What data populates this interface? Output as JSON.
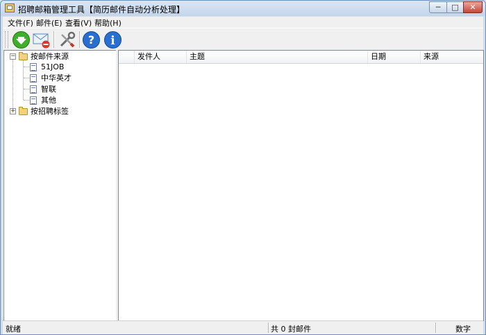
{
  "window": {
    "title": "招聘邮箱管理工具【简历邮件自动分析处理】",
    "minimize": "─",
    "maximize": "□",
    "close": "✕"
  },
  "menu": [
    "文件(F)",
    "邮件(E)",
    "查看(V)",
    "帮助(H)"
  ],
  "toolbar": {
    "buttons": [
      {
        "icon": "download-arrow-icon"
      },
      {
        "icon": "mail-delete-icon"
      },
      {
        "icon": "tools-icon"
      },
      {
        "icon": "help-icon",
        "glyph": "?"
      },
      {
        "icon": "info-icon",
        "glyph": "i"
      }
    ]
  },
  "tree": {
    "group1": {
      "label": "按邮件来源",
      "expander": "−",
      "children": [
        "51JOB",
        "中华英才",
        "智联",
        "其他"
      ]
    },
    "group2": {
      "label": "按招聘标签",
      "expander": "+"
    }
  },
  "list": {
    "columns": [
      "发件人",
      "主题",
      "日期",
      "来源"
    ]
  },
  "status": {
    "left": "就绪",
    "center": "共 0 封邮件",
    "right": "数字"
  },
  "colors": {
    "accent": "#2a6fcf",
    "green": "#3fae2a",
    "red": "#d8382e"
  }
}
